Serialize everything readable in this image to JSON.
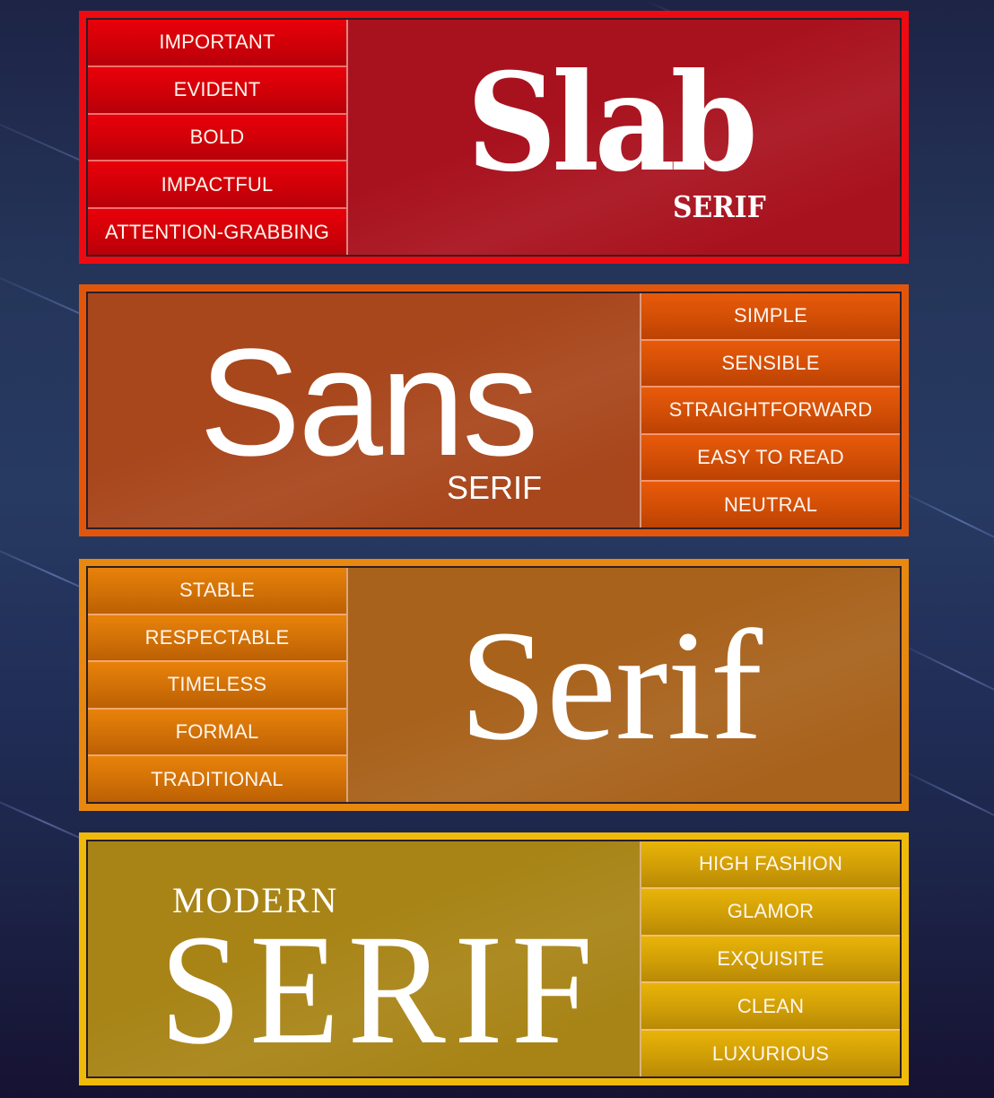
{
  "categories": [
    {
      "id": "slab",
      "title": "Slab",
      "subtitle": "SERIF",
      "accent_color": "#ee0a10",
      "traits": [
        "IMPORTANT",
        "EVIDENT",
        "BOLD",
        "IMPACTFUL",
        "ATTENTION-GRABBING"
      ]
    },
    {
      "id": "sans",
      "title": "Sans",
      "subtitle": "SERIF",
      "accent_color": "#e2560c",
      "traits": [
        "SIMPLE",
        "SENSIBLE",
        "STRAIGHTFORWARD",
        "EASY TO READ",
        "NEUTRAL"
      ]
    },
    {
      "id": "serif",
      "title": "Serif",
      "subtitle": "",
      "accent_color": "#e8880e",
      "traits": [
        "STABLE",
        "RESPECTABLE",
        "TIMELESS",
        "FORMAL",
        "TRADITIONAL"
      ]
    },
    {
      "id": "modern-serif",
      "title": "SERIF",
      "subtitle": "MODERN",
      "accent_color": "#f0ba0a",
      "traits": [
        "HIGH FASHION",
        "GLAMOR",
        "EXQUISITE",
        "CLEAN",
        "LUXURIOUS"
      ]
    }
  ]
}
